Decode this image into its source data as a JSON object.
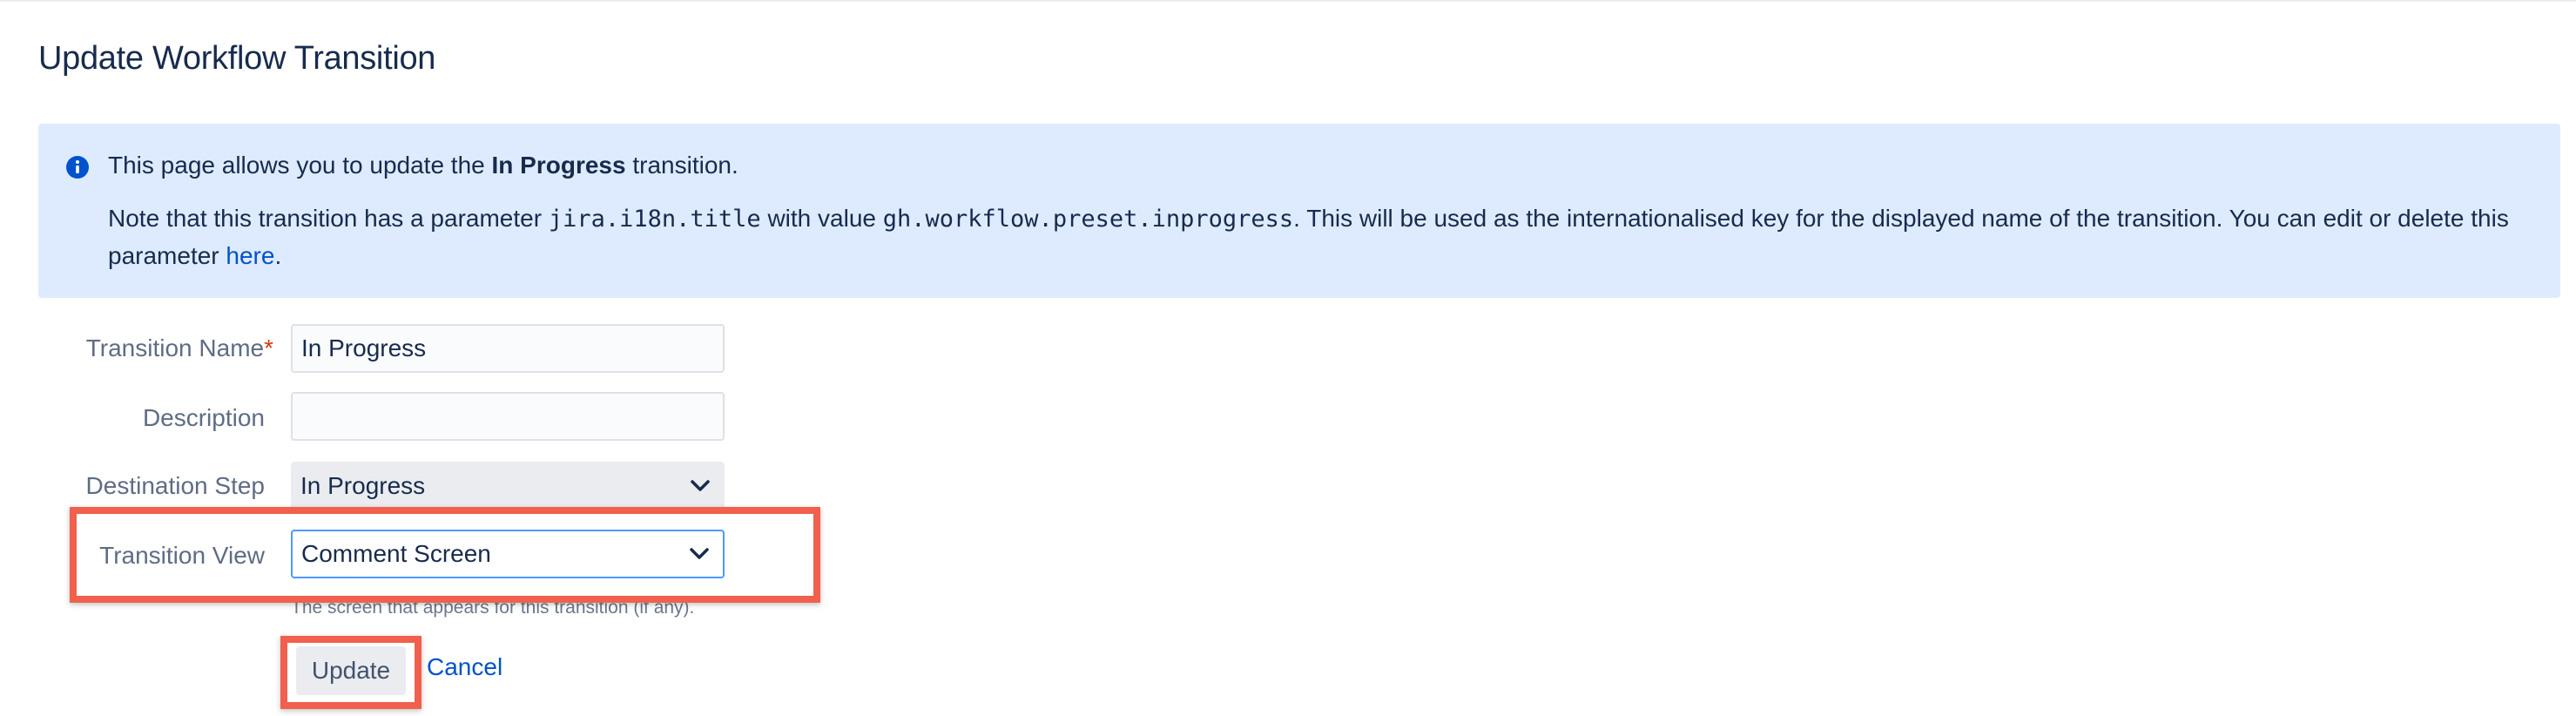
{
  "page": {
    "title": "Update Workflow Transition"
  },
  "info_panel": {
    "icon": "info-icon",
    "line1_prefix": "This page allows you to update the ",
    "line1_bold": "In Progress",
    "line1_suffix": " transition.",
    "line2_part1": "Note that this transition has a parameter ",
    "line2_param_key": "jira.i18n.title",
    "line2_part2": " with value ",
    "line2_param_value": "gh.workflow.preset.inprogress",
    "line2_part3": ". This will be used as the internationalised key for the displayed name of the transition. You can edit or delete this parameter ",
    "line2_link": "here",
    "line2_end": "."
  },
  "form": {
    "transition_name": {
      "label": "Transition Name",
      "required_marker": "*",
      "value": "In Progress"
    },
    "description": {
      "label": "Description",
      "value": ""
    },
    "destination_step": {
      "label": "Destination Step",
      "selected": "In Progress"
    },
    "transition_view": {
      "label": "Transition View",
      "selected": "Comment Screen",
      "help_text": "The screen that appears for this transition (if any)."
    },
    "update_label": "Update",
    "cancel_label": "Cancel"
  },
  "colors": {
    "highlight": "#f0604d",
    "info_background": "#deebff",
    "link": "#0052cc",
    "focus_border": "#4c9aff"
  }
}
